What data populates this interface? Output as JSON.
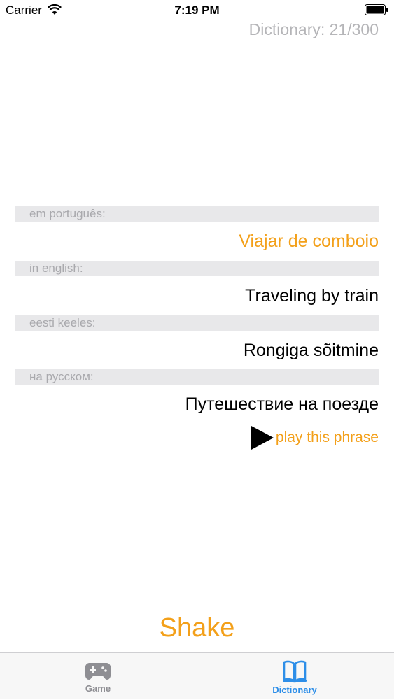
{
  "status_bar": {
    "carrier": "Carrier",
    "time": "7:19 PM"
  },
  "dictionary_counter": "Dictionary: 21/300",
  "sections": [
    {
      "header": "em português:",
      "phrase": "Viajar de comboio"
    },
    {
      "header": "in english:",
      "phrase": "Traveling by train"
    },
    {
      "header": "eesti keeles:",
      "phrase": "Rongiga sõitmine"
    },
    {
      "header": "на русском:",
      "phrase": "Путешествие на поезде"
    }
  ],
  "play_label": "play this phrase",
  "shake_label": "Shake",
  "tab_bar": {
    "tabs": [
      {
        "label": "Game",
        "icon": "gamepad-icon",
        "selected": false
      },
      {
        "label": "Dictionary",
        "icon": "book-icon",
        "selected": true
      }
    ]
  },
  "colors": {
    "accent": "#f3a01a",
    "tab_selected": "#2d8ee8",
    "tab_unselected": "#8e8e93",
    "header_bg": "#e8e8ea",
    "muted_text": "#b5b5b8"
  }
}
